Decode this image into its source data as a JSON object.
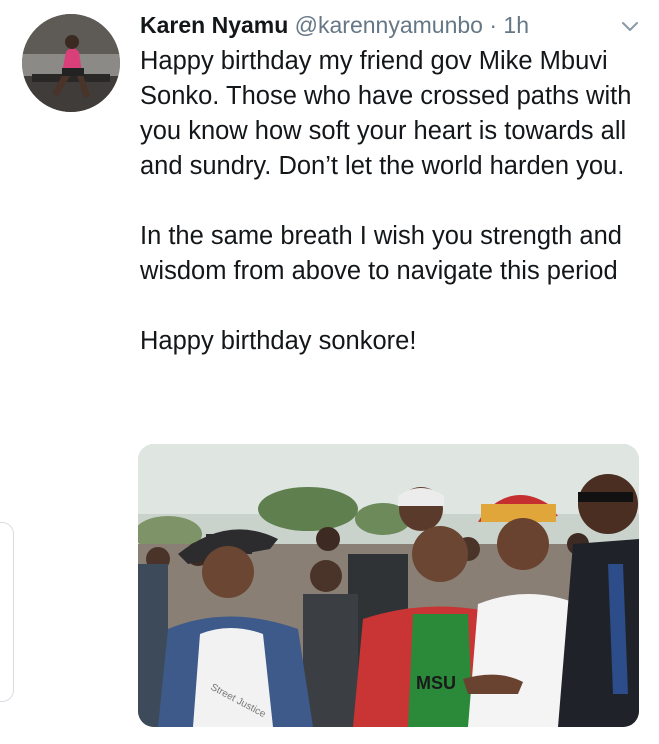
{
  "tweet": {
    "author_name": "Karen Nyamu",
    "handle": "@karennyamunbo",
    "separator": "·",
    "time": "1h",
    "paragraphs": [
      "Happy birthday my friend gov Mike Mbuvi Sonko. Those who have crossed paths with you know how soft your heart is towards all and sundry. Don’t let the world harden you.",
      "In the same breath I wish you strength and wisdom from above to navigate this period",
      "Happy birthday sonkore!"
    ],
    "photo_shirt_text": "MSU",
    "photo_tshirt_print": "Street Justice"
  },
  "icons": {
    "more": "chevron-down-icon",
    "avatar": "profile-photo"
  },
  "colors": {
    "text": "#14171a",
    "secondary": "#657786",
    "background": "#ffffff"
  }
}
